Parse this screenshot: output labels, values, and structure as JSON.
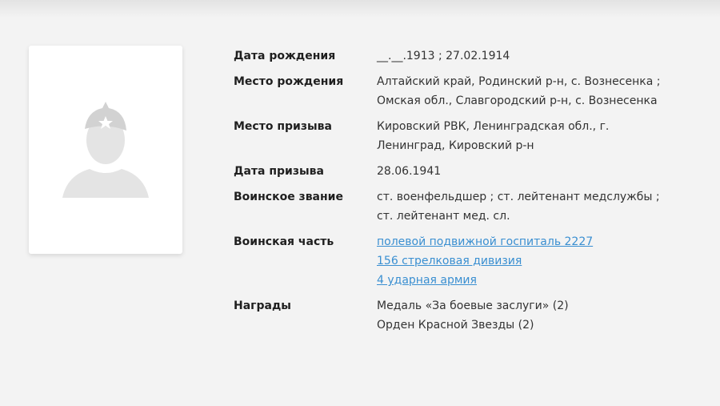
{
  "photo": {
    "placeholder_icon": "soldier-silhouette-icon"
  },
  "fields": {
    "birth_date": {
      "label": "Дата рождения",
      "value": "__.__.1913 ; 27.02.1914"
    },
    "birth_place": {
      "label": "Место рождения",
      "value": "Алтайский край, Родинский р-н, с. Вознесенка ; Омская обл., Славгородский р-н, с. Вознесенка"
    },
    "draft_place": {
      "label": "Место призыва",
      "value": "Кировский РВК, Ленинградская обл., г. Ленинград, Кировский р-н"
    },
    "draft_date": {
      "label": "Дата призыва",
      "value": "28.06.1941"
    },
    "rank": {
      "label": "Воинское звание",
      "value": "ст. военфельдшер ; ст. лейтенант медслужбы ; ст. лейтенант мед. сл."
    },
    "unit": {
      "label": "Воинская часть",
      "links": [
        "полевой подвижной госпиталь 2227",
        "156 стрелковая дивизия",
        "4 ударная армия"
      ]
    },
    "awards": {
      "label": "Награды",
      "items": [
        "Медаль «За боевые заслуги» (2)",
        "Орден Красной Звезды (2)"
      ]
    }
  },
  "colors": {
    "link": "#3a8fd1",
    "background": "#f3f3f3"
  }
}
